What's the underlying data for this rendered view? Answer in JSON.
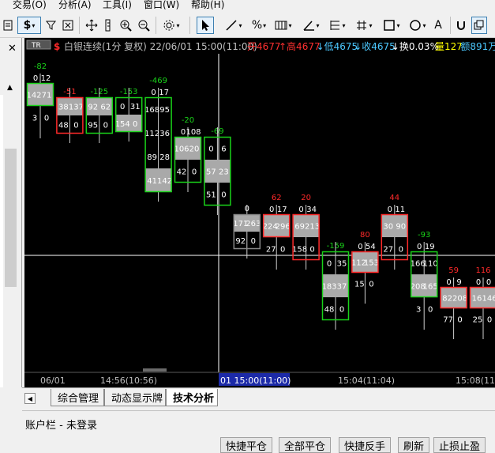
{
  "menu": {
    "items": [
      "交易(O)",
      "分析(A)",
      "工具(I)",
      "窗口(W)",
      "帮助(H)"
    ]
  },
  "toolbar": {
    "icons": [
      "page-icon",
      "dollar-icon",
      "filter-icon",
      "sort-icon",
      "move-icon",
      "ruler-icon",
      "zoom-in-icon",
      "zoom-out-icon",
      "gear-icon",
      "cursor-icon",
      "line-icon",
      "percent-icon",
      "grid-icon",
      "angle-icon",
      "list-icon",
      "hash-icon",
      "rectangle-icon",
      "circle-icon",
      "text-icon",
      "magnet-icon",
      "copy-icon"
    ],
    "symbols": [
      "$",
      "%",
      "A"
    ]
  },
  "chart": {
    "tr_label": "TR",
    "header_top": "-82",
    "title": "白银连续(1分 复权) 22/06/01 15:00(11:00)",
    "stats": [
      {
        "text": "开4677",
        "color": "#ff3030"
      },
      {
        "text": "↑高4677",
        "color": "#ff3030"
      },
      {
        "text": "↓低4675",
        "color": "#4cc8ff"
      },
      {
        "text": "↓收4675",
        "color": "#4cc8ff"
      },
      {
        "text": "↓换0.03%",
        "color": "#ffffff"
      },
      {
        "text": "量127",
        "color": "#ffff00"
      },
      {
        "text": "额891万",
        "color": "#4cc8ff"
      }
    ],
    "bars": [
      {
        "delta": "-82",
        "dc": "g",
        "top": [
          "0",
          "12"
        ],
        "cells": [
          {
            "b": "142",
            "a": "71",
            "gray": true
          }
        ],
        "bottom": [
          "3",
          "0"
        ]
      },
      {
        "delta": "-51",
        "dc": "r",
        "top": [],
        "cells": [
          {
            "b": "38",
            "a": "137",
            "gray": true
          },
          {
            "b": "48",
            "a": "0",
            "gray": false
          }
        ],
        "bottom": []
      },
      {
        "delta": "-125",
        "dc": "g",
        "top": [],
        "cells": [
          {
            "b": "92",
            "a": "62",
            "gray": true
          },
          {
            "b": "95",
            "a": "0",
            "gray": false
          }
        ],
        "bottom": []
      },
      {
        "delta": "-153",
        "dc": "g",
        "top": [],
        "cells": [
          {
            "b": "0",
            "a": "31",
            "gray": false
          },
          {
            "b": "154",
            "a": "0",
            "gray": true
          }
        ],
        "bottom": []
      },
      {
        "delta": "-469",
        "dc": "g",
        "top": [
          "0",
          "17"
        ],
        "cells": [
          {
            "b": "168",
            "a": "95",
            "gray": false
          },
          {
            "b": "112",
            "a": "36",
            "gray": false
          },
          {
            "b": "89",
            "a": "28",
            "gray": false
          },
          {
            "b": "41",
            "a": "142",
            "gray": true
          }
        ],
        "bottom": []
      },
      {
        "delta": "-20",
        "dc": "g",
        "top": [
          "0",
          "108"
        ],
        "cells": [
          {
            "b": "106",
            "a": "20",
            "gray": true
          },
          {
            "b": "42",
            "a": "0",
            "gray": false
          }
        ],
        "bottom": []
      },
      {
        "delta": "-69",
        "dc": "g",
        "top": [],
        "cells": [
          {
            "b": "0",
            "a": "6",
            "gray": false
          },
          {
            "b": "57",
            "a": "23",
            "gray": true
          },
          {
            "b": "51",
            "a": "0",
            "gray": false
          }
        ],
        "bottom": []
      },
      {
        "delta": "0",
        "dc": "w",
        "top": [],
        "cells": [
          {
            "b": "171",
            "a": "263",
            "gray": true
          },
          {
            "b": "92",
            "a": "0",
            "gray": false
          }
        ],
        "bottom": []
      },
      {
        "delta": "62",
        "dc": "r",
        "top": [
          "0",
          "17"
        ],
        "cells": [
          {
            "b": "224",
            "a": "296",
            "gray": true
          }
        ],
        "bottom": [
          "27",
          "0"
        ]
      },
      {
        "delta": "20",
        "dc": "r",
        "top": [
          "0",
          "34"
        ],
        "cells": [
          {
            "b": "69",
            "a": "213",
            "gray": true
          },
          {
            "b": "158",
            "a": "0",
            "gray": false
          }
        ],
        "bottom": []
      },
      {
        "delta": "-159",
        "dc": "g",
        "top": [],
        "cells": [
          {
            "b": "0",
            "a": "35",
            "gray": false
          },
          {
            "b": "183",
            "a": "37",
            "gray": true
          },
          {
            "b": "48",
            "a": "0",
            "gray": false
          }
        ],
        "bottom": []
      },
      {
        "delta": "80",
        "dc": "r",
        "top": [
          "0",
          "54"
        ],
        "cells": [
          {
            "b": "112",
            "a": "153",
            "gray": true
          }
        ],
        "bottom": [
          "15",
          "0"
        ]
      },
      {
        "delta": "44",
        "dc": "r",
        "top": [
          "0",
          "11"
        ],
        "cells": [
          {
            "b": "30",
            "a": "90",
            "gray": true
          },
          {
            "b": "27",
            "a": "0",
            "gray": false
          }
        ],
        "bottom": []
      },
      {
        "delta": "-93",
        "dc": "g",
        "top": [
          "0",
          "19"
        ],
        "cells": [
          {
            "b": "166",
            "a": "110",
            "gray": false
          },
          {
            "b": "208",
            "a": "165",
            "gray": true
          }
        ],
        "bottom": [
          "3",
          "0"
        ]
      },
      {
        "delta": "59",
        "dc": "r",
        "top": [
          "0",
          "9"
        ],
        "cells": [
          {
            "b": "82",
            "a": "208",
            "gray": true
          }
        ],
        "bottom": [
          "77",
          "0"
        ]
      },
      {
        "delta": "116",
        "dc": "r",
        "top": [
          "0",
          "0"
        ],
        "cells": [
          {
            "b": "16",
            "a": "146",
            "gray": true
          }
        ],
        "bottom": [
          "25",
          "0"
        ]
      }
    ],
    "time_labels": [
      "06/01",
      "14:56(10:56)",
      "15:04(11:04)",
      "15:08(11"
    ],
    "cursor_time": "01 15:00(11:00)"
  },
  "tabs": {
    "items": [
      "综合管理",
      "动态显示牌",
      "技术分析"
    ],
    "active": 2
  },
  "account": {
    "title": "账户栏 - 未登录",
    "buttons": [
      "快捷平仓",
      "全部平仓",
      "快捷反手",
      "刷新",
      "止损止盈"
    ]
  }
}
